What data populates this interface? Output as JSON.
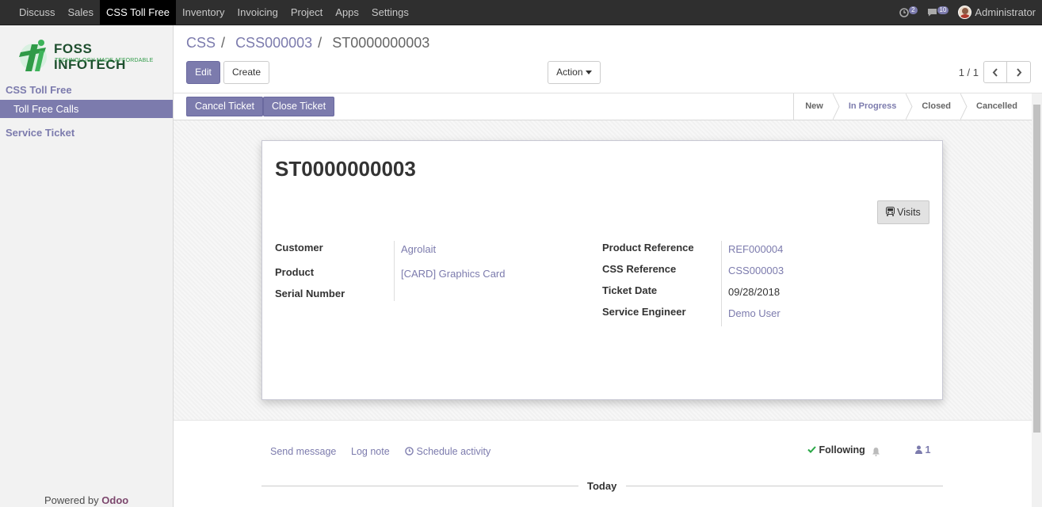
{
  "topbar": {
    "menu": [
      "Discuss",
      "Sales",
      "CSS Toll Free",
      "Inventory",
      "Invoicing",
      "Project",
      "Apps",
      "Settings"
    ],
    "activity_count": "2",
    "message_count": "10",
    "user": "Administrator"
  },
  "sidebar": {
    "logo_name": "FOSS INFOTECH",
    "logo_tagline": "TECHNOLOGY MADE AFFORDABLE",
    "section1": "CSS Toll Free",
    "item_active": "Toll Free Calls",
    "section2": "Service Ticket",
    "powered_prefix": "Powered by",
    "powered_brand": "Odoo"
  },
  "breadcrumb": {
    "b1": "CSS",
    "b2": "CSS000003",
    "current": "ST0000000003",
    "sep": "/"
  },
  "buttons": {
    "edit": "Edit",
    "create": "Create",
    "action": "Action",
    "cancel_ticket": "Cancel Ticket",
    "close_ticket": "Close Ticket",
    "visits": "Visits"
  },
  "pager": {
    "value": "1 / 1"
  },
  "stages": [
    {
      "label": "New",
      "current": false
    },
    {
      "label": "In Progress",
      "current": true
    },
    {
      "label": "Closed",
      "current": false
    },
    {
      "label": "Cancelled",
      "current": false
    }
  ],
  "record": {
    "title": "ST0000000003",
    "left": [
      {
        "label": "Customer",
        "value": "Agrolait",
        "link": true
      },
      {
        "label": "Product",
        "value": "[CARD] Graphics Card",
        "link": true
      },
      {
        "label": "Serial Number",
        "value": "",
        "link": false
      }
    ],
    "right": [
      {
        "label": "Product Reference",
        "value": "REF000004",
        "link": true
      },
      {
        "label": "CSS Reference",
        "value": "CSS000003",
        "link": true
      },
      {
        "label": "Ticket Date",
        "value": "09/28/2018",
        "link": false
      },
      {
        "label": "Service Engineer",
        "value": "Demo User",
        "link": true
      }
    ]
  },
  "chatter": {
    "send_message": "Send message",
    "log_note": "Log note",
    "schedule_activity": "Schedule activity",
    "following": "Following",
    "followers": "1",
    "today": "Today"
  },
  "colors": {
    "primary": "#7c7bad",
    "topbar": "#2f2f2f",
    "sidebar": "#f2f2f2"
  }
}
